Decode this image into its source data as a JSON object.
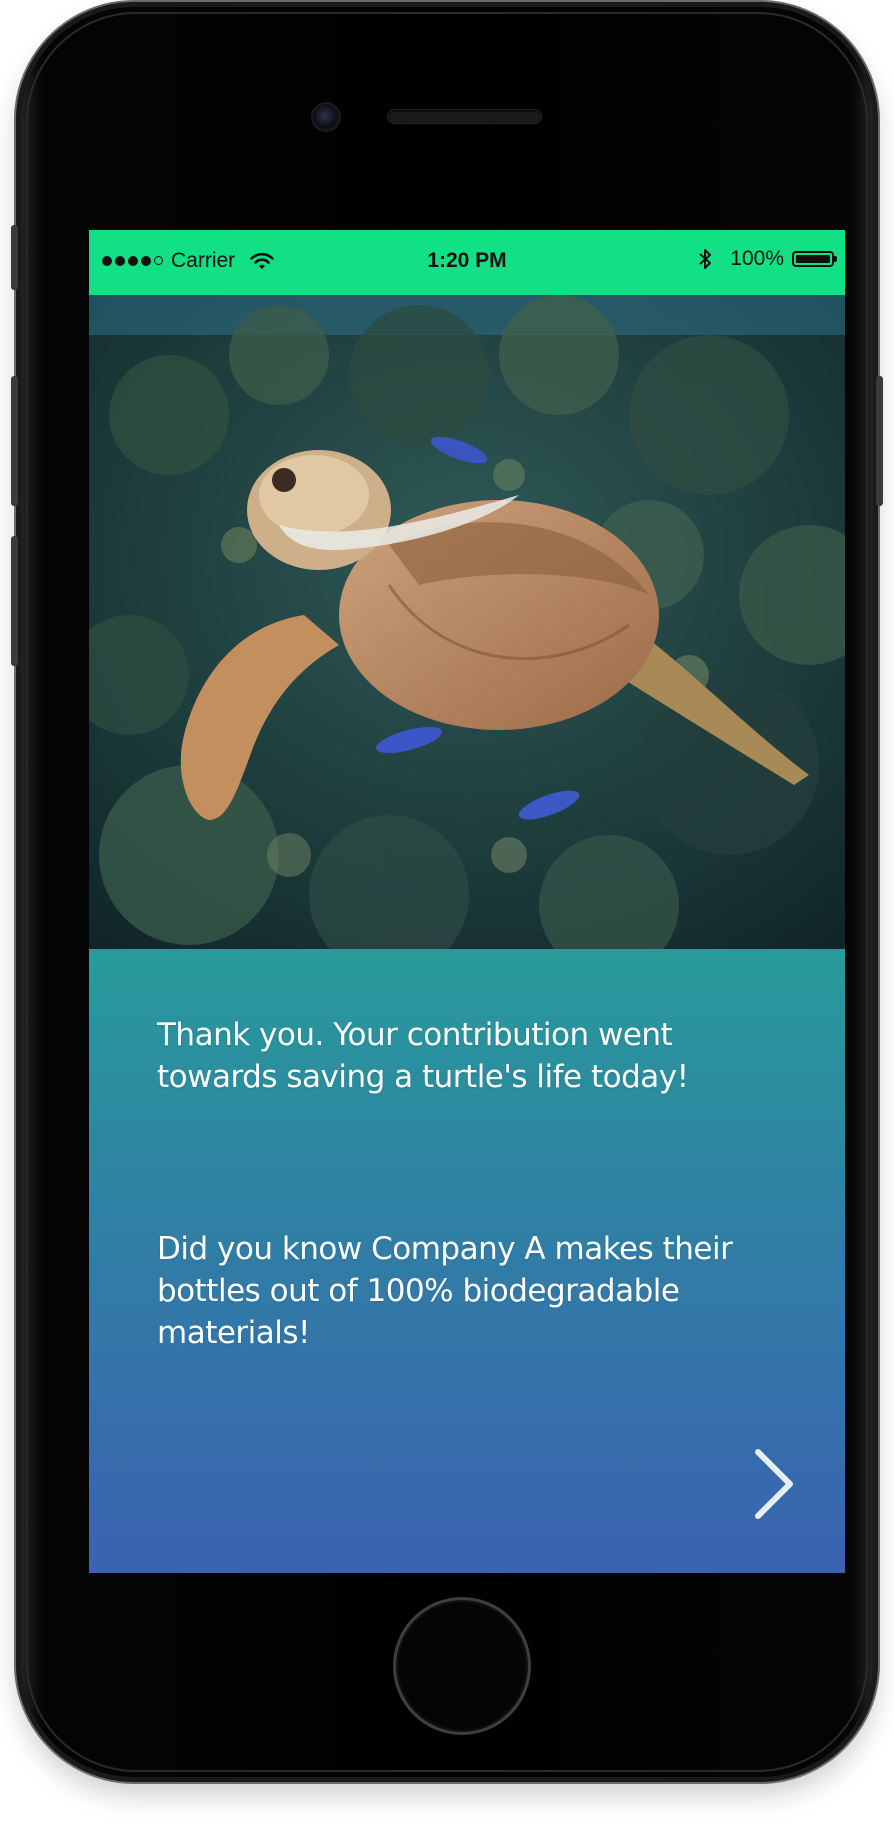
{
  "status_bar": {
    "carrier": "Carrier",
    "time": "1:20 PM",
    "battery_percent": "100%",
    "signal_bars_filled": 4,
    "signal_bars_total": 5,
    "battery_level": 1.0,
    "background_color": "#12e084"
  },
  "hero": {
    "icon": "sea-turtle-photo"
  },
  "content": {
    "thank_you": "Thank you. Your contribution went towards saving a turtle's life today!",
    "fact": "Did you know Company A makes their bottles out of 100% biodegradable materials!",
    "next_icon": "chevron-right-icon",
    "gradient_top": "#279b9a",
    "gradient_bottom": "#3a62b0"
  }
}
